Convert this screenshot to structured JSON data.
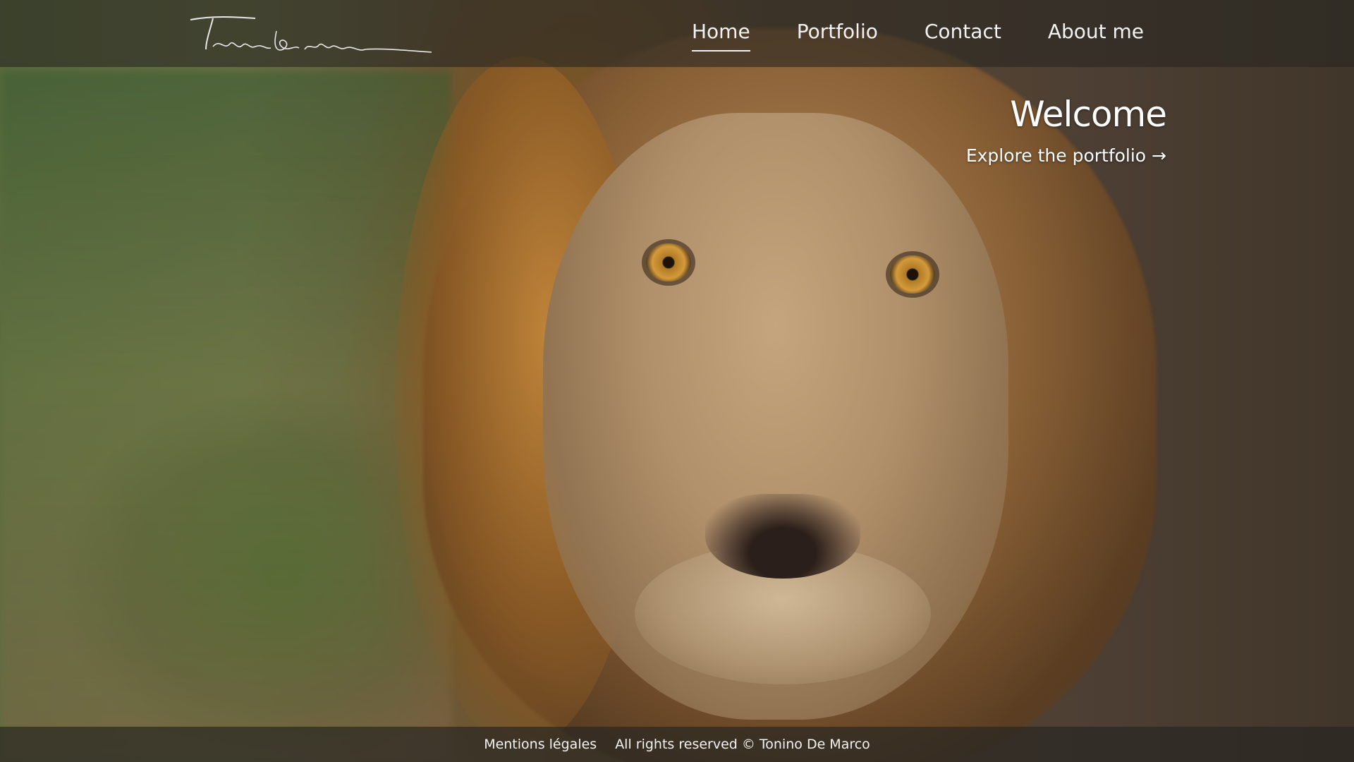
{
  "header": {
    "logo_text": "Tonino de marco",
    "nav": [
      {
        "label": "Home",
        "active": true
      },
      {
        "label": "Portfolio",
        "active": false
      },
      {
        "label": "Contact",
        "active": false
      },
      {
        "label": "About me",
        "active": false
      }
    ]
  },
  "hero": {
    "title": "Welcome",
    "link": "Explore the portfolio →"
  },
  "footer": {
    "legal_link": "Mentions légales",
    "copyright": "All rights reserved © Tonino De Marco"
  },
  "background": {
    "subject": "lion-photo"
  }
}
